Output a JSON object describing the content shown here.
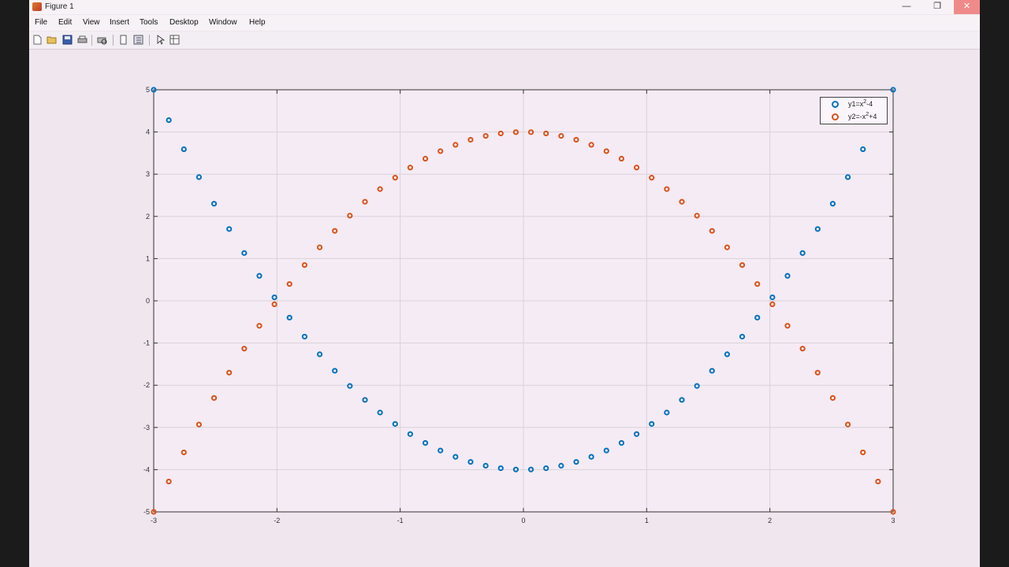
{
  "window": {
    "title": "Figure 1",
    "minimize_glyph": "—",
    "restore_glyph": "❐",
    "close_glyph": "✕"
  },
  "menubar": {
    "items": [
      "File",
      "Edit",
      "View",
      "Insert",
      "Tools",
      "Desktop",
      "Window",
      "Help"
    ]
  },
  "toolbar": {
    "icons": [
      "new-figure-icon",
      "open-file-icon",
      "save-icon",
      "print-icon",
      "print-preview-icon",
      "hide-plot-tools-icon",
      "show-plot-tools-icon",
      "pointer-icon",
      "property-inspector-icon"
    ]
  },
  "colors": {
    "series1": "#0072bd",
    "series2": "#d95319",
    "axes_bg": "#f5ebf4",
    "figure_bg": "#efe6ee"
  },
  "chart_data": {
    "type": "scatter",
    "title": "",
    "xlabel": "",
    "ylabel": "",
    "xlim": [
      -3,
      3
    ],
    "ylim": [
      -5,
      5
    ],
    "xticks": [
      -3,
      -2,
      -1,
      0,
      1,
      2,
      3
    ],
    "yticks": [
      -5,
      -4,
      -3,
      -2,
      -1,
      0,
      1,
      2,
      3,
      4,
      5
    ],
    "grid": true,
    "legend_position": "top-right",
    "x": [
      -3.0,
      -2.8776,
      -2.7551,
      -2.6327,
      -2.5102,
      -2.3878,
      -2.2653,
      -2.1429,
      -2.0204,
      -1.898,
      -1.7755,
      -1.6531,
      -1.5306,
      -1.4082,
      -1.2857,
      -1.1633,
      -1.0408,
      -0.9184,
      -0.7959,
      -0.6735,
      -0.551,
      -0.4286,
      -0.3061,
      -0.1837,
      -0.0612,
      0.0612,
      0.1837,
      0.3061,
      0.4286,
      0.551,
      0.6735,
      0.7959,
      0.9184,
      1.0408,
      1.1633,
      1.2857,
      1.4082,
      1.5306,
      1.6531,
      1.7755,
      1.898,
      2.0204,
      2.1429,
      2.2653,
      2.3878,
      2.5102,
      2.6327,
      2.7551,
      2.8776,
      3.0
    ],
    "series": [
      {
        "name": "y1=x^2-4",
        "legend_main": "y1=x",
        "legend_sup": "2",
        "legend_tail": "-4",
        "color": "#0072bd",
        "marker": "circle",
        "values": [
          5.0,
          4.281,
          3.591,
          2.931,
          2.301,
          1.701,
          1.132,
          0.592,
          0.082,
          -0.398,
          -0.848,
          -1.267,
          -1.657,
          -2.017,
          -2.347,
          -2.647,
          -2.917,
          -3.157,
          -3.367,
          -3.546,
          -3.696,
          -3.816,
          -3.906,
          -3.966,
          -3.996,
          -3.996,
          -3.966,
          -3.906,
          -3.816,
          -3.696,
          -3.546,
          -3.367,
          -3.157,
          -2.917,
          -2.647,
          -2.347,
          -2.017,
          -1.657,
          -1.267,
          -0.848,
          -0.398,
          0.082,
          0.592,
          1.132,
          1.701,
          2.301,
          2.931,
          3.591,
          4.281,
          5.0
        ]
      },
      {
        "name": "y2=-x^2+4",
        "legend_main": "y2=-x",
        "legend_sup": "2",
        "legend_tail": "+4",
        "color": "#d95319",
        "marker": "circle",
        "values": [
          -5.0,
          -4.281,
          -3.591,
          -2.931,
          -2.301,
          -1.701,
          -1.132,
          -0.592,
          -0.082,
          0.398,
          0.848,
          1.267,
          1.657,
          2.017,
          2.347,
          2.647,
          2.917,
          3.157,
          3.367,
          3.546,
          3.696,
          3.816,
          3.906,
          3.966,
          3.996,
          3.996,
          3.966,
          3.906,
          3.816,
          3.696,
          3.546,
          3.367,
          3.157,
          2.917,
          2.647,
          2.347,
          2.017,
          1.657,
          1.267,
          0.848,
          0.398,
          -0.082,
          -0.592,
          -1.132,
          -1.701,
          -2.301,
          -2.931,
          -3.591,
          -4.281,
          -5.0
        ]
      }
    ]
  }
}
